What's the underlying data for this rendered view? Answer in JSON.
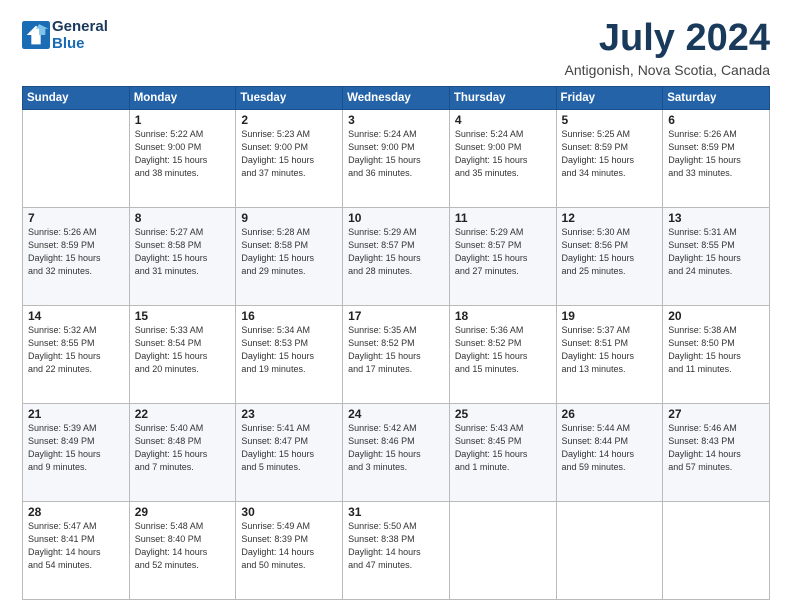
{
  "app": {
    "logo_line1": "General",
    "logo_line2": "Blue"
  },
  "header": {
    "month_year": "July 2024",
    "location": "Antigonish, Nova Scotia, Canada"
  },
  "days_of_week": [
    "Sunday",
    "Monday",
    "Tuesday",
    "Wednesday",
    "Thursday",
    "Friday",
    "Saturday"
  ],
  "weeks": [
    [
      {
        "day": "",
        "info": ""
      },
      {
        "day": "1",
        "info": "Sunrise: 5:22 AM\nSunset: 9:00 PM\nDaylight: 15 hours\nand 38 minutes."
      },
      {
        "day": "2",
        "info": "Sunrise: 5:23 AM\nSunset: 9:00 PM\nDaylight: 15 hours\nand 37 minutes."
      },
      {
        "day": "3",
        "info": "Sunrise: 5:24 AM\nSunset: 9:00 PM\nDaylight: 15 hours\nand 36 minutes."
      },
      {
        "day": "4",
        "info": "Sunrise: 5:24 AM\nSunset: 9:00 PM\nDaylight: 15 hours\nand 35 minutes."
      },
      {
        "day": "5",
        "info": "Sunrise: 5:25 AM\nSunset: 8:59 PM\nDaylight: 15 hours\nand 34 minutes."
      },
      {
        "day": "6",
        "info": "Sunrise: 5:26 AM\nSunset: 8:59 PM\nDaylight: 15 hours\nand 33 minutes."
      }
    ],
    [
      {
        "day": "7",
        "info": "Sunrise: 5:26 AM\nSunset: 8:59 PM\nDaylight: 15 hours\nand 32 minutes."
      },
      {
        "day": "8",
        "info": "Sunrise: 5:27 AM\nSunset: 8:58 PM\nDaylight: 15 hours\nand 31 minutes."
      },
      {
        "day": "9",
        "info": "Sunrise: 5:28 AM\nSunset: 8:58 PM\nDaylight: 15 hours\nand 29 minutes."
      },
      {
        "day": "10",
        "info": "Sunrise: 5:29 AM\nSunset: 8:57 PM\nDaylight: 15 hours\nand 28 minutes."
      },
      {
        "day": "11",
        "info": "Sunrise: 5:29 AM\nSunset: 8:57 PM\nDaylight: 15 hours\nand 27 minutes."
      },
      {
        "day": "12",
        "info": "Sunrise: 5:30 AM\nSunset: 8:56 PM\nDaylight: 15 hours\nand 25 minutes."
      },
      {
        "day": "13",
        "info": "Sunrise: 5:31 AM\nSunset: 8:55 PM\nDaylight: 15 hours\nand 24 minutes."
      }
    ],
    [
      {
        "day": "14",
        "info": "Sunrise: 5:32 AM\nSunset: 8:55 PM\nDaylight: 15 hours\nand 22 minutes."
      },
      {
        "day": "15",
        "info": "Sunrise: 5:33 AM\nSunset: 8:54 PM\nDaylight: 15 hours\nand 20 minutes."
      },
      {
        "day": "16",
        "info": "Sunrise: 5:34 AM\nSunset: 8:53 PM\nDaylight: 15 hours\nand 19 minutes."
      },
      {
        "day": "17",
        "info": "Sunrise: 5:35 AM\nSunset: 8:52 PM\nDaylight: 15 hours\nand 17 minutes."
      },
      {
        "day": "18",
        "info": "Sunrise: 5:36 AM\nSunset: 8:52 PM\nDaylight: 15 hours\nand 15 minutes."
      },
      {
        "day": "19",
        "info": "Sunrise: 5:37 AM\nSunset: 8:51 PM\nDaylight: 15 hours\nand 13 minutes."
      },
      {
        "day": "20",
        "info": "Sunrise: 5:38 AM\nSunset: 8:50 PM\nDaylight: 15 hours\nand 11 minutes."
      }
    ],
    [
      {
        "day": "21",
        "info": "Sunrise: 5:39 AM\nSunset: 8:49 PM\nDaylight: 15 hours\nand 9 minutes."
      },
      {
        "day": "22",
        "info": "Sunrise: 5:40 AM\nSunset: 8:48 PM\nDaylight: 15 hours\nand 7 minutes."
      },
      {
        "day": "23",
        "info": "Sunrise: 5:41 AM\nSunset: 8:47 PM\nDaylight: 15 hours\nand 5 minutes."
      },
      {
        "day": "24",
        "info": "Sunrise: 5:42 AM\nSunset: 8:46 PM\nDaylight: 15 hours\nand 3 minutes."
      },
      {
        "day": "25",
        "info": "Sunrise: 5:43 AM\nSunset: 8:45 PM\nDaylight: 15 hours\nand 1 minute."
      },
      {
        "day": "26",
        "info": "Sunrise: 5:44 AM\nSunset: 8:44 PM\nDaylight: 14 hours\nand 59 minutes."
      },
      {
        "day": "27",
        "info": "Sunrise: 5:46 AM\nSunset: 8:43 PM\nDaylight: 14 hours\nand 57 minutes."
      }
    ],
    [
      {
        "day": "28",
        "info": "Sunrise: 5:47 AM\nSunset: 8:41 PM\nDaylight: 14 hours\nand 54 minutes."
      },
      {
        "day": "29",
        "info": "Sunrise: 5:48 AM\nSunset: 8:40 PM\nDaylight: 14 hours\nand 52 minutes."
      },
      {
        "day": "30",
        "info": "Sunrise: 5:49 AM\nSunset: 8:39 PM\nDaylight: 14 hours\nand 50 minutes."
      },
      {
        "day": "31",
        "info": "Sunrise: 5:50 AM\nSunset: 8:38 PM\nDaylight: 14 hours\nand 47 minutes."
      },
      {
        "day": "",
        "info": ""
      },
      {
        "day": "",
        "info": ""
      },
      {
        "day": "",
        "info": ""
      }
    ]
  ]
}
